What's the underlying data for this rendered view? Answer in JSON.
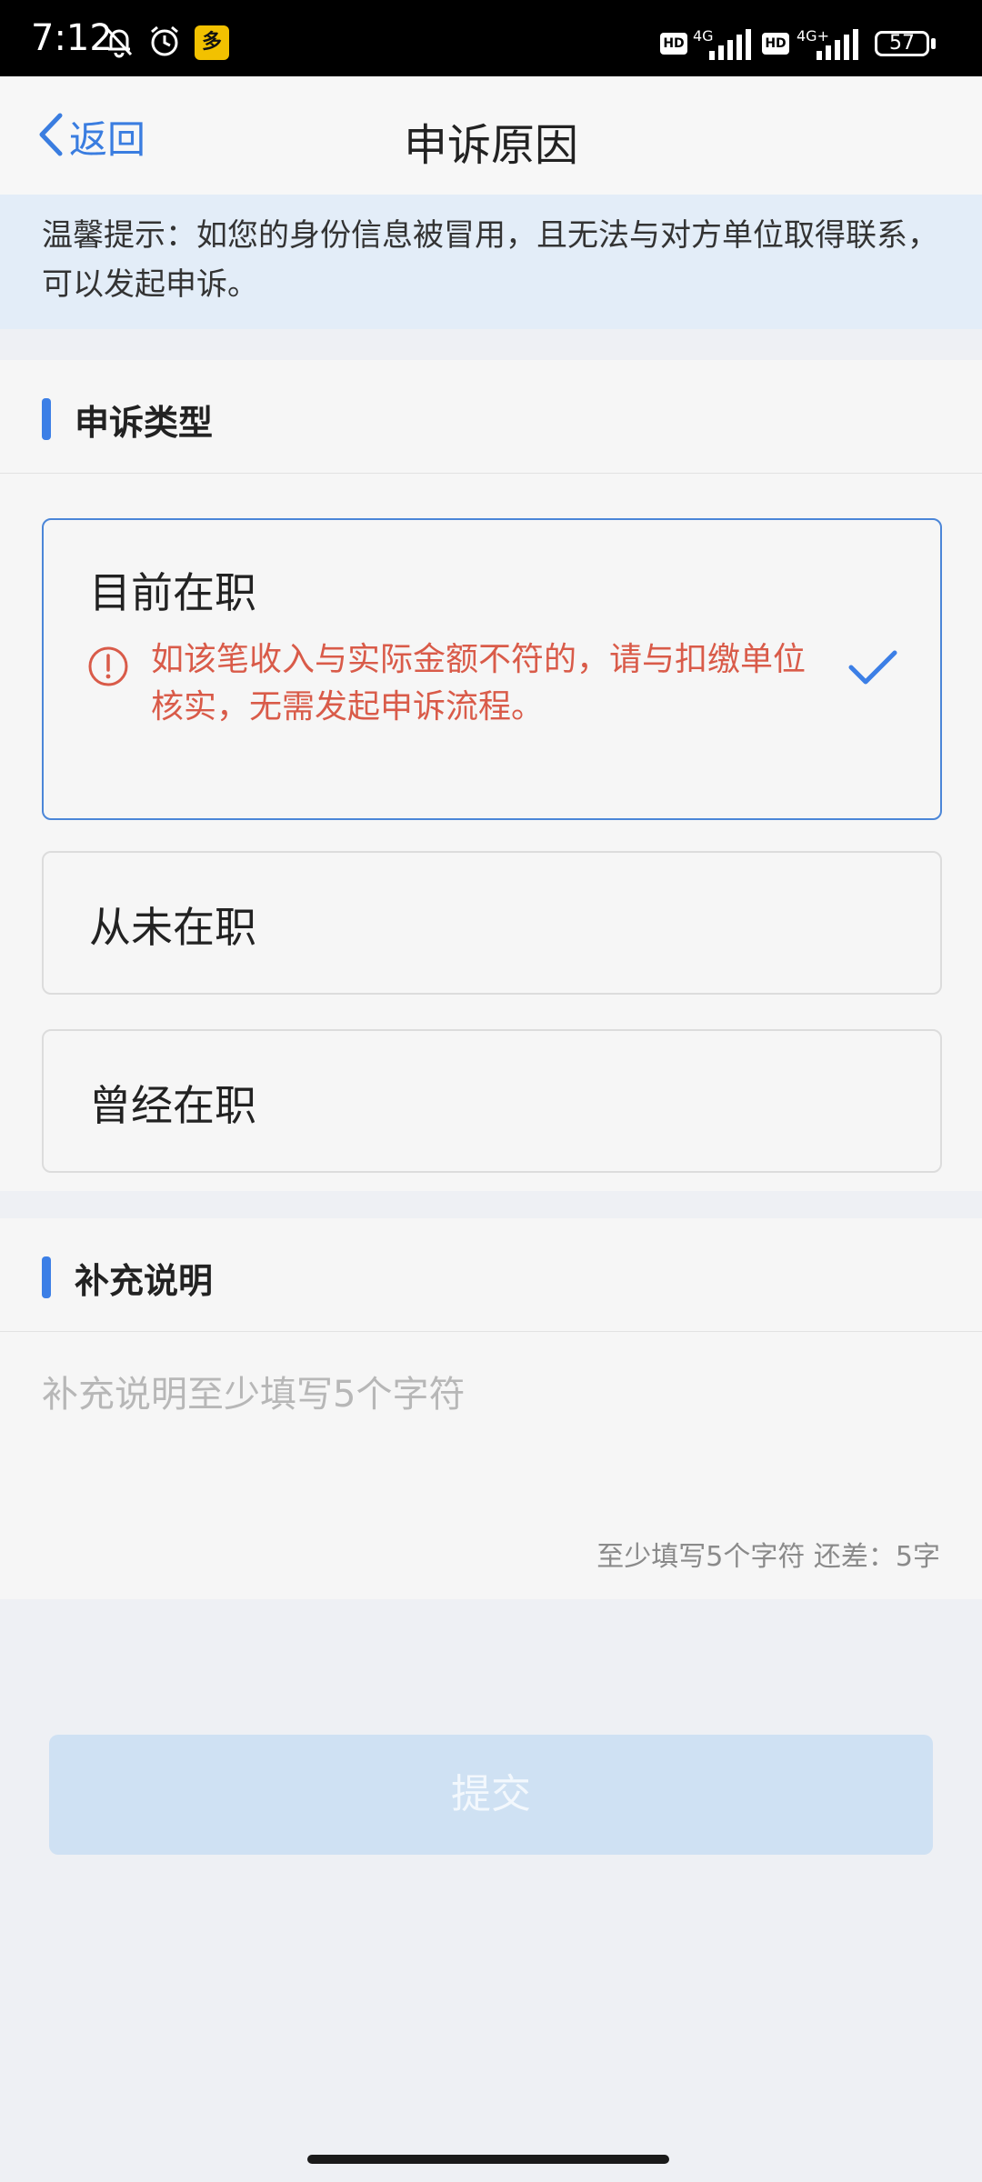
{
  "status_bar": {
    "time": "7:12",
    "app_badge": "多",
    "hd1": "HD",
    "net1": "4G",
    "hd2": "HD",
    "net2": "4G+",
    "battery": "57"
  },
  "nav": {
    "back_label": "返回",
    "title": "申诉原因"
  },
  "tip": {
    "text": "温馨提示：如您的身份信息被冒用，且无法与对方单位取得联系，可以发起申诉。"
  },
  "appeal_type": {
    "title": "申诉类型",
    "options": [
      {
        "label": "目前在职",
        "selected": true,
        "warning": "如该笔收入与实际金额不符的，请与扣缴单位核实，无需发起申诉流程。"
      },
      {
        "label": "从未在职",
        "selected": false
      },
      {
        "label": "曾经在职",
        "selected": false
      }
    ]
  },
  "supplement": {
    "title": "补充说明",
    "placeholder": "补充说明至少填写5个字符",
    "char_count": "至少填写5个字符 还差：5字"
  },
  "submit": {
    "label": "提交"
  },
  "colors": {
    "accent": "#3c7fe6",
    "warning": "#d95b49",
    "tip_bg": "#e3edf8",
    "submit_disabled": "#cfe1f3"
  }
}
